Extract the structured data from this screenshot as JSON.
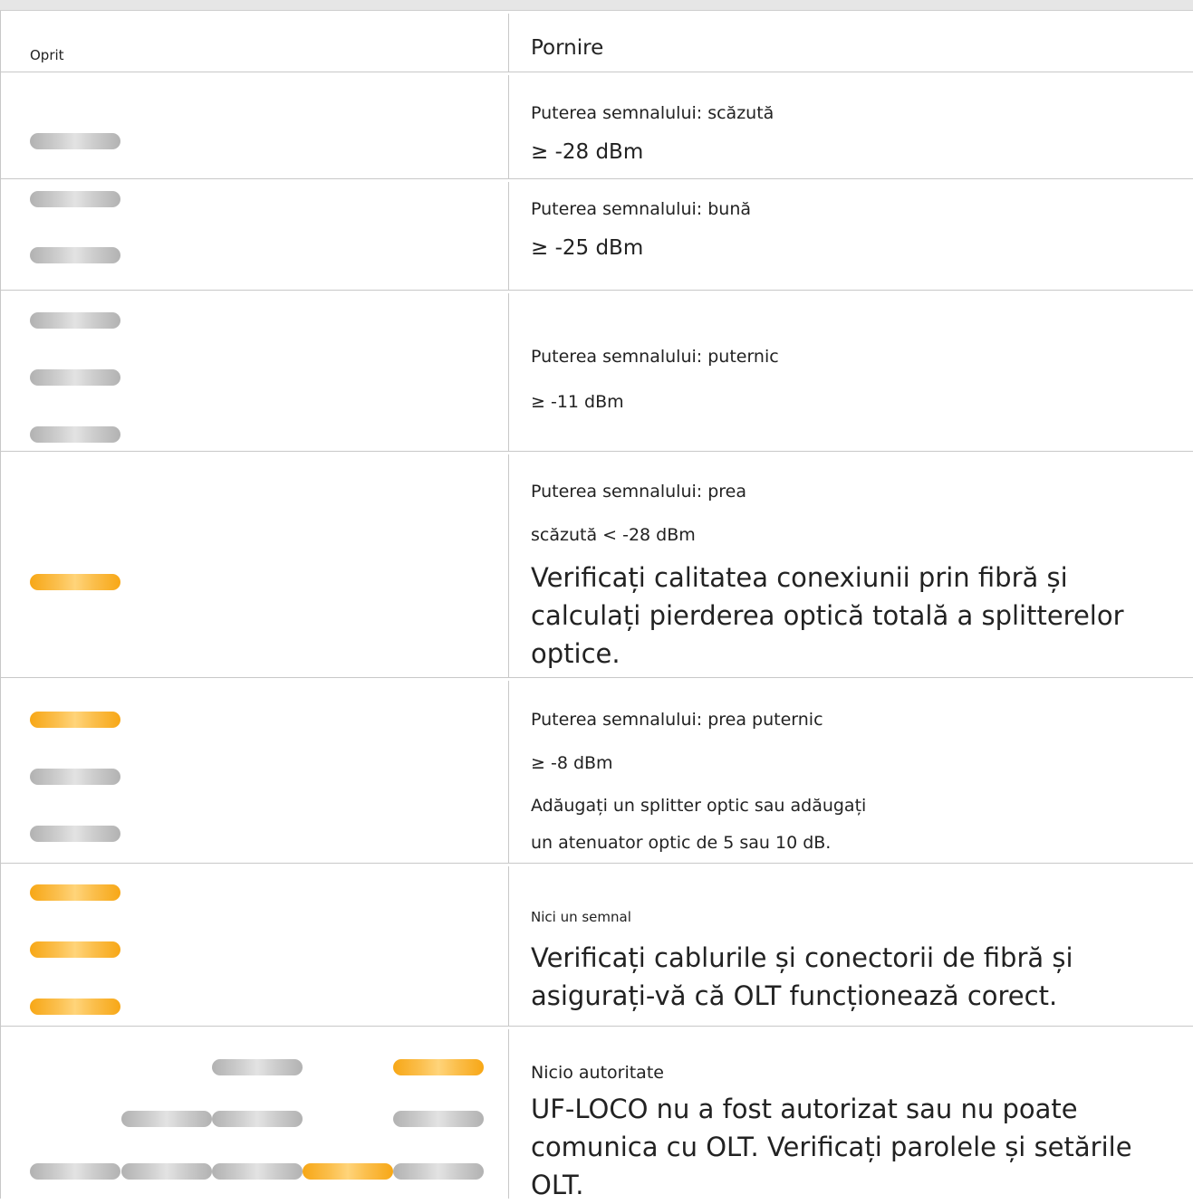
{
  "header": {
    "left_label": "Oprit",
    "right_label": "Pornire"
  },
  "rows": [
    {
      "leds": [
        "gray"
      ],
      "lines": [
        "Puterea semnalului: scăzută",
        "≥ -28 dBm"
      ]
    },
    {
      "leds": [
        "gray",
        "gray"
      ],
      "lines": [
        "Puterea semnalului: bună",
        "≥ -25 dBm"
      ]
    },
    {
      "leds": [
        "gray",
        "gray",
        "gray"
      ],
      "lines": [
        "Puterea semnalului: puternic",
        "≥ -11 dBm"
      ]
    },
    {
      "leds": [
        "orange"
      ],
      "lines": [
        "Puterea semnalului: prea",
        "scăzută < -28 dBm",
        "Verificați calitatea conexiunii prin fibră și calculați pierderea optică totală a splitterelor optice."
      ]
    },
    {
      "leds": [
        "orange",
        "gray",
        "gray"
      ],
      "lines": [
        "Puterea semnalului: prea puternic",
        "≥ -8 dBm",
        "Adăugați un splitter optic sau adăugați",
        "un atenuator optic de 5 sau 10 dB."
      ]
    },
    {
      "leds": [
        "orange",
        "orange",
        "orange"
      ],
      "lines": [
        "Nici un semnal",
        "Verificați cablurile și conectorii de fibră și asigurați-vă că OLT funcționează corect."
      ]
    },
    {
      "led_matrix": [
        [
          "none",
          "none",
          "gray",
          "none",
          "orange"
        ],
        [
          "none",
          "gray",
          "gray",
          "none",
          "gray"
        ],
        [
          "gray",
          "gray",
          "gray",
          "orange",
          "gray"
        ]
      ],
      "lines": [
        "Nicio autoritate",
        "UF-LOCO nu a fost autorizat sau nu poate comunica cu OLT. Verificați parolele și setările OLT."
      ]
    }
  ],
  "colors": {
    "led_gray": "#c4c4c4",
    "led_orange": "#f9b22e",
    "grid_line": "#c8c8c8"
  }
}
